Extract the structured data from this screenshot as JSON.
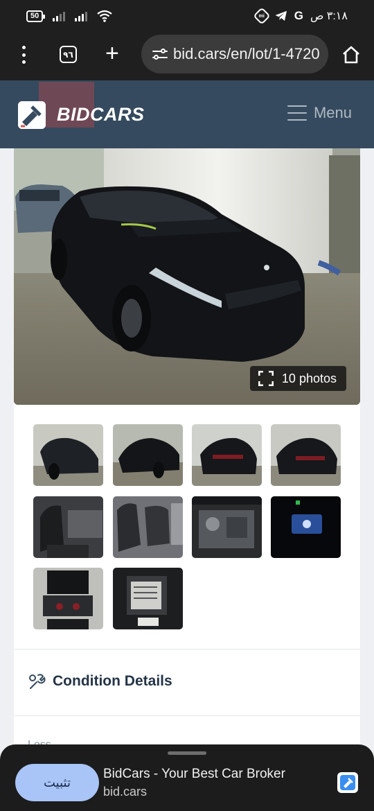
{
  "status_bar": {
    "battery": "50",
    "time": "٣:١٨ ص",
    "google_letter": "G"
  },
  "browser": {
    "tab_count": "٩٦",
    "url": "bid.cars/en/lot/1-4720"
  },
  "site": {
    "logo": "BIDCARS",
    "menu_label": "Menu"
  },
  "gallery": {
    "photos_count": "10 photos"
  },
  "condition": {
    "title": "Condition Details",
    "first_field": "Loss"
  },
  "install_banner": {
    "install_label": "تثبيت",
    "app_name": "BidCars - Your Best Car Broker",
    "app_domain": "bid.cars"
  },
  "colors": {
    "header_bg": "#354a5e",
    "browser_bg": "#1f1f1f",
    "install_button": "#a9c4f7"
  }
}
